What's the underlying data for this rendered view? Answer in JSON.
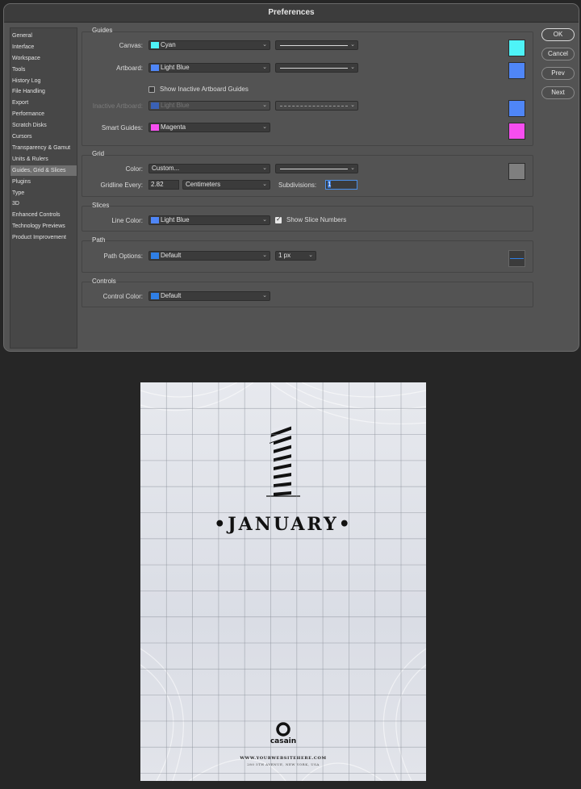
{
  "window": {
    "title": "Preferences"
  },
  "sidebar": {
    "items": [
      {
        "label": "General"
      },
      {
        "label": "Interface"
      },
      {
        "label": "Workspace"
      },
      {
        "label": "Tools"
      },
      {
        "label": "History Log"
      },
      {
        "label": "File Handling"
      },
      {
        "label": "Export"
      },
      {
        "label": "Performance"
      },
      {
        "label": "Scratch Disks"
      },
      {
        "label": "Cursors"
      },
      {
        "label": "Transparency & Gamut"
      },
      {
        "label": "Units & Rulers"
      },
      {
        "label": "Guides, Grid & Slices",
        "selected": true
      },
      {
        "label": "Plugins"
      },
      {
        "label": "Type"
      },
      {
        "label": "3D"
      },
      {
        "label": "Enhanced Controls"
      },
      {
        "label": "Technology Previews"
      },
      {
        "label": "Product Improvement"
      }
    ]
  },
  "guides": {
    "title": "Guides",
    "canvas": {
      "label": "Canvas:",
      "value": "Cyan",
      "color": "#4ef3f7"
    },
    "artboard": {
      "label": "Artboard:",
      "value": "Light Blue",
      "color": "#4f86f7"
    },
    "show_inactive_label": "Show Inactive Artboard Guides",
    "show_inactive_checked": false,
    "inactive": {
      "label": "Inactive Artboard:",
      "value": "Light Blue",
      "color": "#4f86f7"
    },
    "smart": {
      "label": "Smart Guides:",
      "value": "Magenta",
      "color": "#f74ef0"
    }
  },
  "grid": {
    "title": "Grid",
    "color": {
      "label": "Color:",
      "value": "Custom...",
      "color": "#7f7f7f"
    },
    "every_label": "Gridline Every:",
    "every_value": "2.82",
    "units": "Centimeters",
    "subdivisions_label": "Subdivisions:",
    "subdivisions_value": "1"
  },
  "slices": {
    "title": "Slices",
    "line_color": {
      "label": "Line Color:",
      "value": "Light Blue",
      "color": "#4f86f7"
    },
    "show_numbers_label": "Show Slice Numbers",
    "show_numbers_checked": true
  },
  "path": {
    "title": "Path",
    "options": {
      "label": "Path Options:",
      "value": "Default",
      "color": "#2f7fe6"
    },
    "width": "1 px"
  },
  "controls": {
    "title": "Controls",
    "color": {
      "label": "Control Color:",
      "value": "Default",
      "color": "#2f7fe6"
    }
  },
  "buttons": {
    "ok": "OK",
    "cancel": "Cancel",
    "prev": "Prev",
    "next": "Next"
  },
  "poster": {
    "number": "1",
    "month": "•JANUARY•",
    "brand": "casain",
    "website": "WWW.YOURWEBSITEHERE.COM",
    "address": "280 5TH AVENUE, NEW YORK, USA"
  }
}
